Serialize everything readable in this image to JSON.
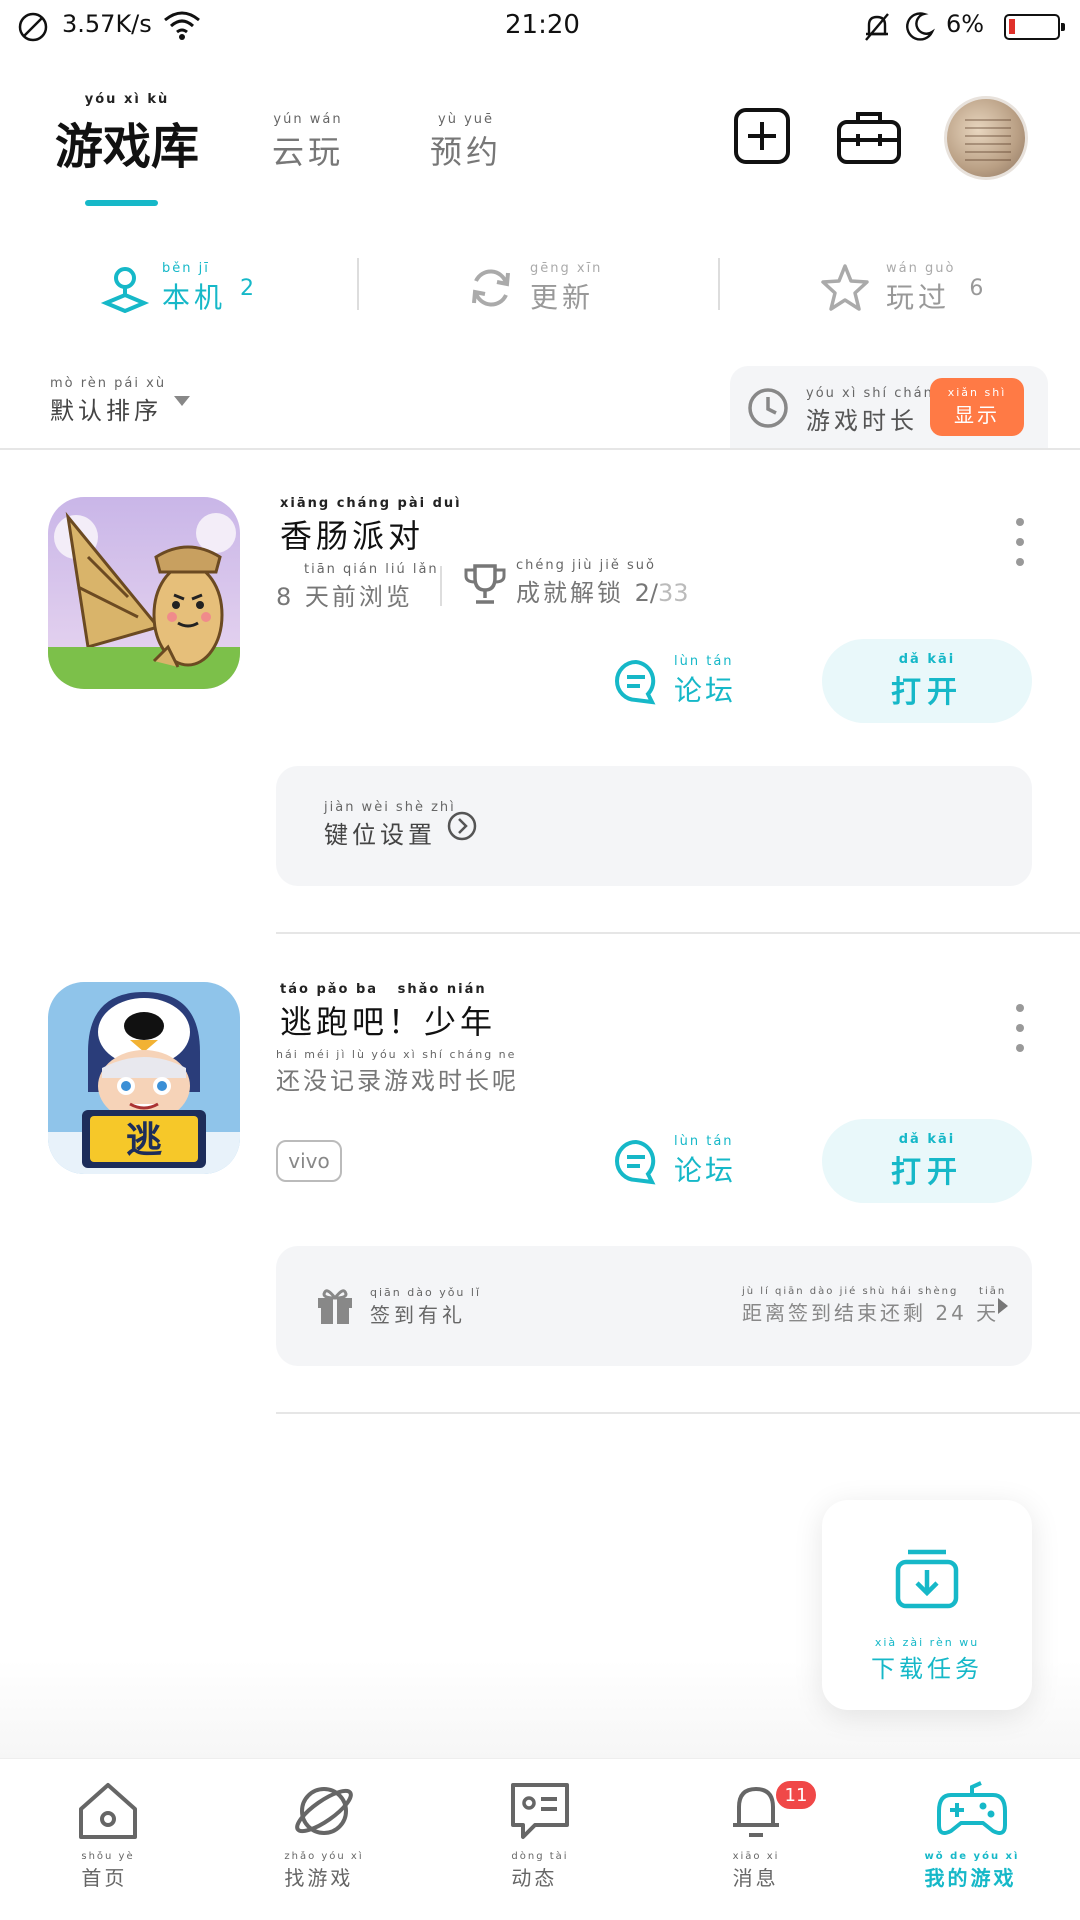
{
  "status_bar": {
    "net_speed": "3.57K/s",
    "time": "21:20",
    "battery": "6%"
  },
  "top_tabs": [
    {
      "label": "游戏库",
      "pinyin": "yóu xì kù"
    },
    {
      "label": "云玩",
      "pinyin": "yún wán"
    },
    {
      "label": "预约",
      "pinyin": "yù yuē"
    }
  ],
  "sub_tabs": [
    {
      "label": "本机",
      "pinyin": "běn jī",
      "count": "2"
    },
    {
      "label": "更新",
      "pinyin": "gēng xīn",
      "count": ""
    },
    {
      "label": "玩过",
      "pinyin": "wán guò",
      "count": "6"
    }
  ],
  "sort": {
    "label": "默认排序",
    "pinyin": "mò rèn pái xù"
  },
  "playtime": {
    "label": "游戏时长",
    "pinyin": "yóu xì shí cháng",
    "show_label": "显示",
    "show_pinyin": "xiǎn shì"
  },
  "games": [
    {
      "title": "香肠派对",
      "title_pinyin": "xiāng cháng pài duì",
      "last_seen": "8 天前浏览",
      "last_seen_pinyin": "tiān qián liú lǎn",
      "achievement_label": "成就解锁",
      "achievement_pinyin": "chéng jiù jiě suǒ",
      "achievement_done": "2/",
      "achievement_total": "33",
      "forum": "论坛",
      "forum_pinyin": "lùn tán",
      "open": "打开",
      "open_pinyin": "dǎ kāi",
      "panel_text": "键位设置",
      "panel_pinyin": "jiàn wèi shè zhì"
    },
    {
      "title": "逃跑吧！少年",
      "title_pinyin": "táo pǎo ba   shǎo nián",
      "no_record": "还没记录游戏时长呢",
      "no_record_pinyin": "hái méi jì lù yóu xì shí cháng ne",
      "tag": "vivo",
      "forum": "论坛",
      "forum_pinyin": "lùn tán",
      "open": "打开",
      "open_pinyin": "dǎ kāi",
      "panel_text": "签到有礼",
      "panel_pinyin": "qiān dào yǒu lǐ",
      "panel_right": "距离签到结束还剩 24 天",
      "panel_right_pinyin": "jù lí qiān dào jié shù hái shèng    tiān"
    }
  ],
  "download": {
    "label": "下载任务",
    "pinyin": "xià zài rèn wu"
  },
  "bottom_nav": [
    {
      "label": "首页",
      "pinyin": "shǒu yè"
    },
    {
      "label": "找游戏",
      "pinyin": "zhǎo yóu xì"
    },
    {
      "label": "动态",
      "pinyin": "dòng tài"
    },
    {
      "label": "消息",
      "pinyin": "xiāo xi",
      "badge": "11"
    },
    {
      "label": "我的游戏",
      "pinyin": "wǒ de yóu xì"
    }
  ],
  "colors": {
    "accent": "#16b8c8",
    "orange": "#ff7a45",
    "badge_red": "#f04848"
  }
}
